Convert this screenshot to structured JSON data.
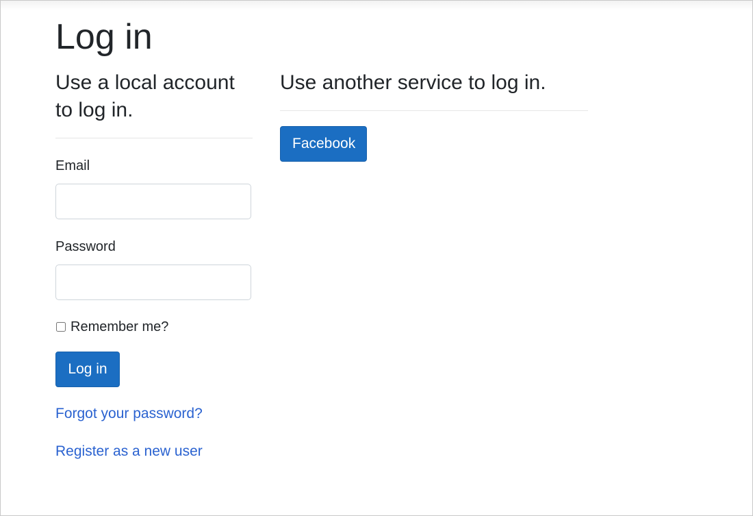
{
  "page": {
    "title": "Log in"
  },
  "local_account": {
    "heading": "Use a local account to log in.",
    "email_label": "Email",
    "email_value": "",
    "password_label": "Password",
    "password_value": "",
    "remember_label": "Remember me?",
    "remember_checked": false,
    "login_button": "Log in",
    "forgot_link": "Forgot your password?",
    "register_link": "Register as a new user"
  },
  "external_login": {
    "heading": "Use another service to log in.",
    "providers": [
      "Facebook"
    ]
  },
  "colors": {
    "primary_button": "#1b6ec2",
    "link": "#2a62d0",
    "text": "#212529"
  }
}
